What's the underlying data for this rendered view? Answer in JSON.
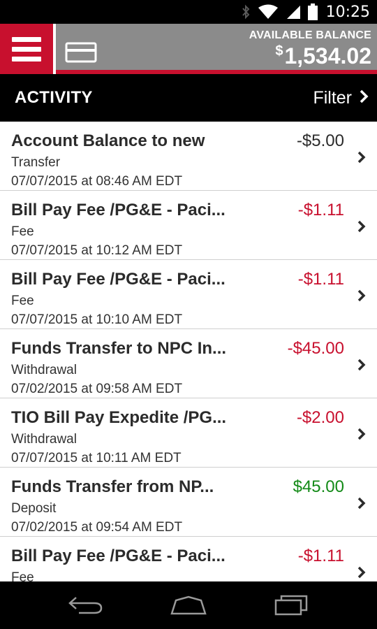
{
  "status_bar": {
    "time": "10:25"
  },
  "header": {
    "balance_label": "AVAILABLE BALANCE",
    "currency_symbol": "$",
    "balance_amount": "1,534.02"
  },
  "activity_bar": {
    "title": "ACTIVITY",
    "filter_label": "Filter"
  },
  "transactions": [
    {
      "title": "Account Balance to new",
      "amount": "-$5.00",
      "type": "Transfer",
      "date": "07/07/2015 at 08:46 AM EDT"
    },
    {
      "title": "Bill Pay Fee /PG&E - Paci...",
      "amount": "-$1.11",
      "type": "Fee",
      "date": "07/07/2015 at 10:12 AM EDT"
    },
    {
      "title": "Bill Pay Fee /PG&E - Paci...",
      "amount": "-$1.11",
      "type": "Fee",
      "date": "07/07/2015 at 10:10 AM EDT"
    },
    {
      "title": "Funds Transfer to NPC In...",
      "amount": "-$45.00",
      "type": "Withdrawal",
      "date": "07/02/2015 at 09:58 AM EDT"
    },
    {
      "title": "TIO Bill Pay Expedite /PG...",
      "amount": "-$2.00",
      "type": "Withdrawal",
      "date": "07/07/2015 at 10:11 AM EDT"
    },
    {
      "title": "Funds Transfer from NP...",
      "amount": "$45.00",
      "type": "Deposit",
      "date": "07/02/2015 at 09:54 AM EDT"
    },
    {
      "title": "Bill Pay Fee /PG&E - Paci...",
      "amount": "-$1.11",
      "type": "Fee",
      "date": ""
    }
  ],
  "colors": {
    "brand_red": "#c8102e",
    "header_gray": "#8b8b8b",
    "negative": "#c8102e",
    "positive": "#138a17",
    "neutral": "#2b2b2b"
  },
  "icons": {
    "menu": "hamburger-icon",
    "card": "card-icon",
    "filter": "chevron-right-icon",
    "row": "chevron-right-icon",
    "nav_back": "back-icon",
    "nav_home": "home-icon",
    "nav_recents": "recents-icon"
  }
}
